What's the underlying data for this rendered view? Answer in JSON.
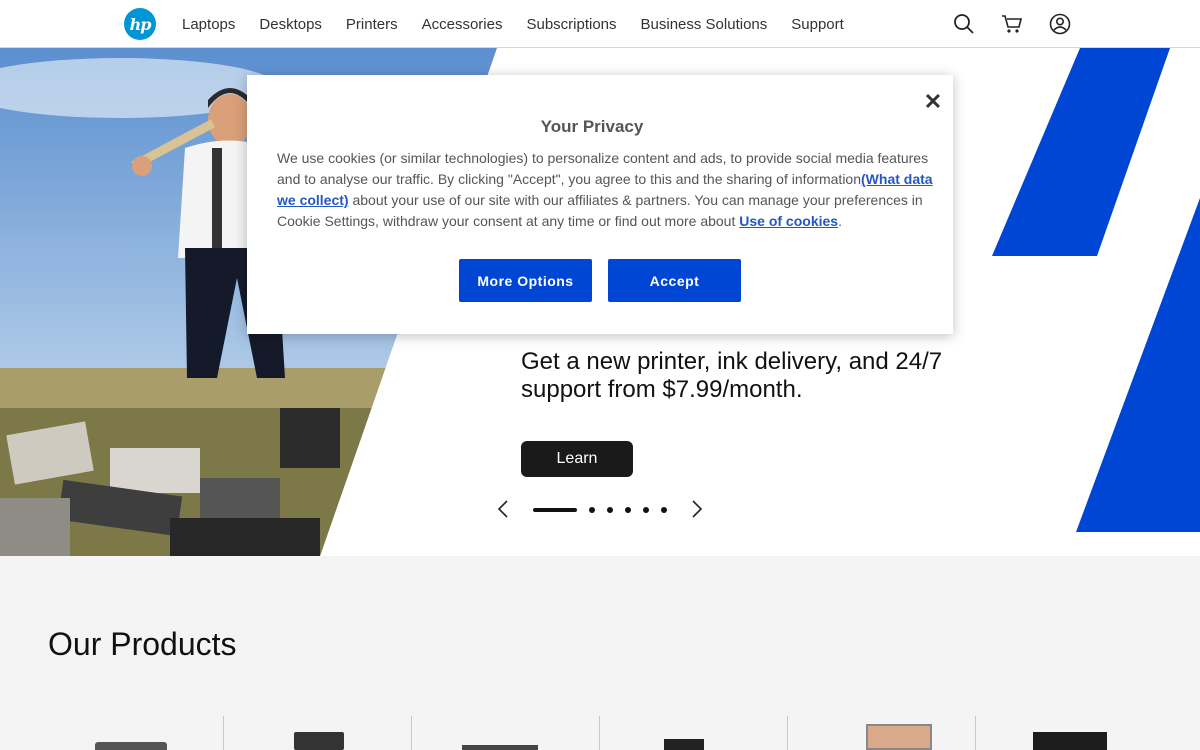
{
  "header": {
    "logo_text": "hp",
    "nav": [
      "Laptops",
      "Desktops",
      "Printers",
      "Accessories",
      "Subscriptions",
      "Business Solutions",
      "Support"
    ],
    "icons": [
      "search-icon",
      "cart-icon",
      "account-icon"
    ]
  },
  "hero": {
    "promo_text": "Get a new printer, ink delivery, and 24/7 support from $7.99/month.",
    "cta_label": "Learn",
    "slide_count": 7,
    "active_slide": 1,
    "accent_color": "#0046d5"
  },
  "products": {
    "title": "Our Products"
  },
  "privacy_modal": {
    "title": "Your Privacy",
    "text_before_link1": "We use cookies (or similar technologies) to personalize content and ads, to provide social media features and to analyse our traffic. By clicking \"Accept\", you agree to this and the sharing of information",
    "link1": "(What data we collect)",
    "text_between": " about your use of our site with our affiliates & partners. You can manage your preferences in Cookie Settings, withdraw your consent at any time or find out more about ",
    "link2": "Use of cookies",
    "text_after": ".",
    "more_options_label": "More Options",
    "accept_label": "Accept",
    "close_label": "✕"
  }
}
